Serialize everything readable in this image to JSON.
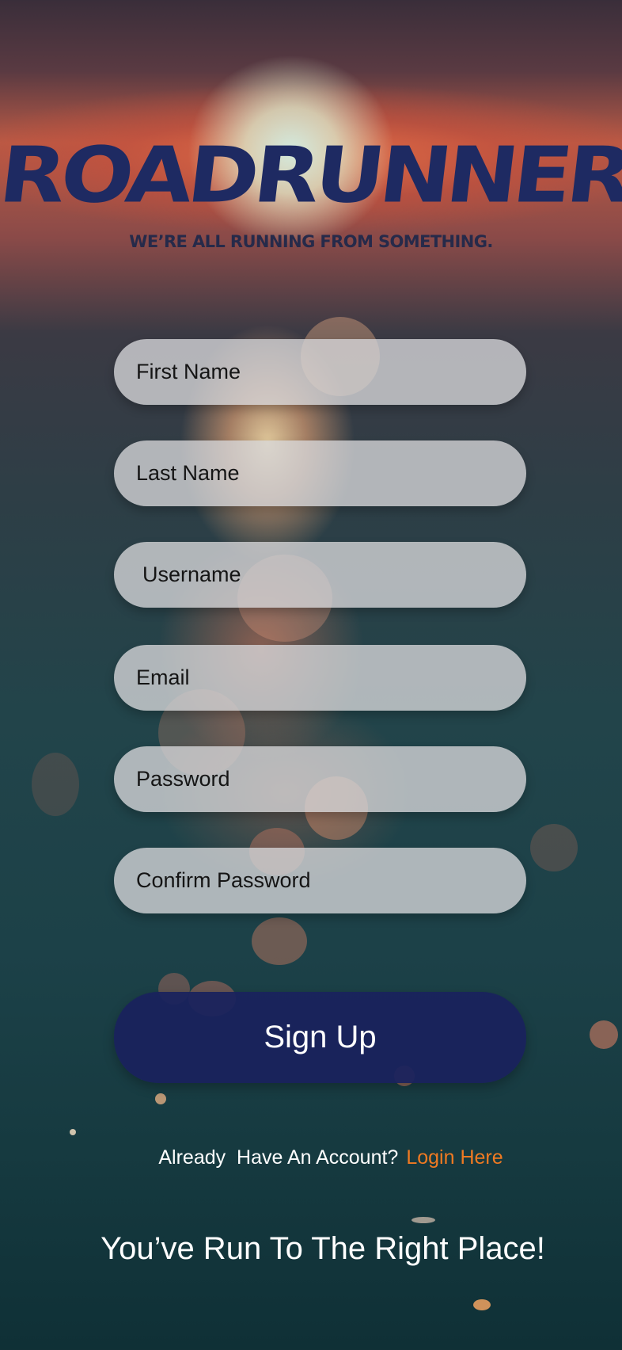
{
  "brand": {
    "logo_text": "ROADRUNNER",
    "tagline": "WE’RE ALL RUNNING FROM SOMETHING.",
    "logo_color": "#1e2a62"
  },
  "form": {
    "first_name": "First Name",
    "last_name": "Last Name",
    "username": "Username",
    "email": "Email",
    "password": "Password",
    "confirm_password": "Confirm Password"
  },
  "signup_button": {
    "label": "Sign Up",
    "color": "#1a225c"
  },
  "login_prompt": {
    "text": "Already  Have An Account?",
    "link_label": "Login Here",
    "link_color": "#f07a22"
  },
  "slogan": "You’ve Run To The Right Place!"
}
